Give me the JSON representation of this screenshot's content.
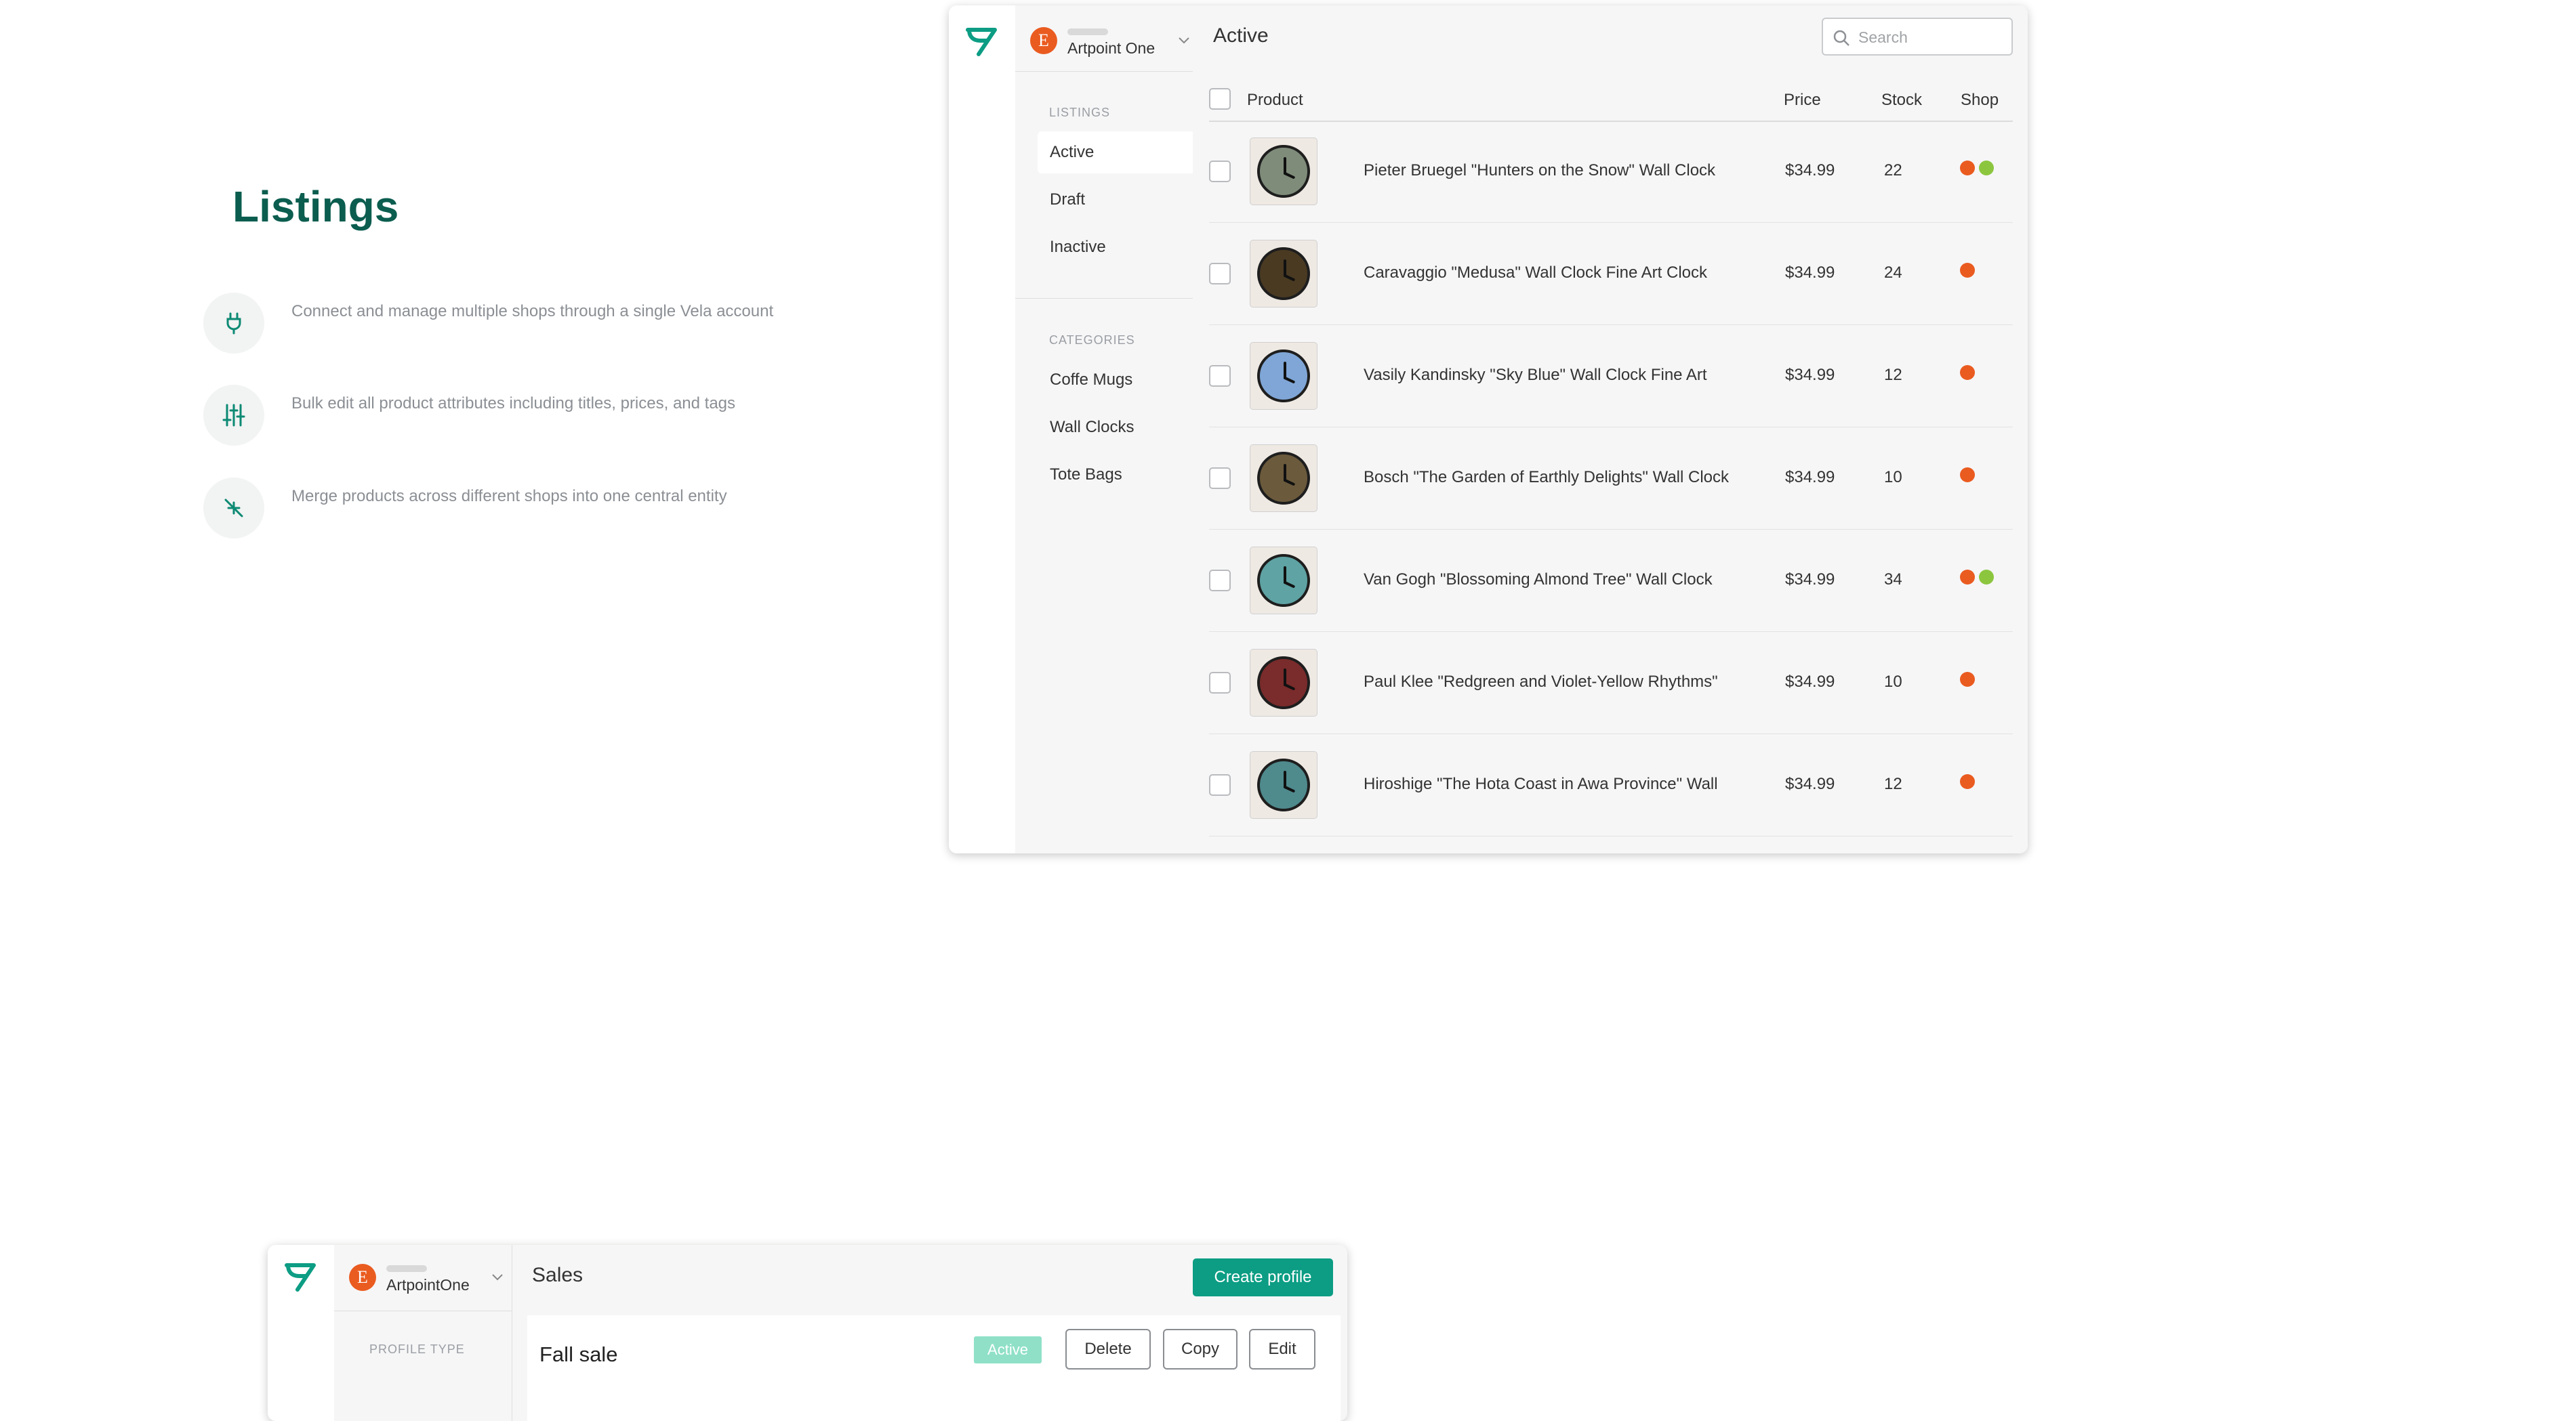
{
  "hero": {
    "title": "Listings",
    "features": [
      {
        "icon": "plug-icon",
        "text": "Connect and manage multiple shops through a single Vela account"
      },
      {
        "icon": "sliders-icon",
        "text": "Bulk edit all product attributes including titles, prices, and tags"
      },
      {
        "icon": "merge-arrows-icon",
        "text": "Merge products across different shops into one central entity"
      }
    ]
  },
  "listings_app": {
    "logo": "vela-logo-icon",
    "shop_selector": {
      "badge": "E",
      "name": "Artpoint One",
      "icon": "chevron-down-icon"
    },
    "sidebar": {
      "listings_heading": "LISTINGS",
      "listings": [
        {
          "label": "Active",
          "selected": true
        },
        {
          "label": "Draft",
          "selected": false
        },
        {
          "label": "Inactive",
          "selected": false
        }
      ],
      "categories_heading": "CATEGORIES",
      "categories": [
        {
          "label": "Coffe Mugs"
        },
        {
          "label": "Wall Clocks"
        },
        {
          "label": "Tote Bags"
        }
      ]
    },
    "page_title": "Active",
    "search": {
      "placeholder": "Search",
      "value": ""
    },
    "table": {
      "columns": {
        "product": "Product",
        "price": "Price",
        "stock": "Stock",
        "shop": "Shop"
      },
      "rows": [
        {
          "product": "Pieter Bruegel \"Hunters on the Snow\" Wall Clock",
          "price": "$34.99",
          "stock": "22",
          "shops": [
            "etsy",
            "shopify"
          ],
          "thumb_color": "#7f8c7a"
        },
        {
          "product": "Caravaggio \"Medusa\" Wall Clock Fine Art Clock",
          "price": "$34.99",
          "stock": "24",
          "shops": [
            "etsy"
          ],
          "thumb_color": "#4a3a22"
        },
        {
          "product": "Vasily Kandinsky \"Sky Blue\" Wall Clock Fine Art",
          "price": "$34.99",
          "stock": "12",
          "shops": [
            "etsy"
          ],
          "thumb_color": "#7fa6d6"
        },
        {
          "product": "Bosch \"The Garden of Earthly Delights\" Wall Clock",
          "price": "$34.99",
          "stock": "10",
          "shops": [
            "etsy"
          ],
          "thumb_color": "#6b5a3c"
        },
        {
          "product": "Van Gogh \"Blossoming Almond Tree\" Wall Clock",
          "price": "$34.99",
          "stock": "34",
          "shops": [
            "etsy",
            "shopify"
          ],
          "thumb_color": "#5fa3a4"
        },
        {
          "product": "Paul Klee \"Redgreen and Violet-Yellow Rhythms\"",
          "price": "$34.99",
          "stock": "10",
          "shops": [
            "etsy"
          ],
          "thumb_color": "#7a2b2b"
        },
        {
          "product": "Hiroshige \"The Hota Coast in Awa Province\" Wall",
          "price": "$34.99",
          "stock": "12",
          "shops": [
            "etsy"
          ],
          "thumb_color": "#4f8a8d"
        }
      ]
    },
    "shop_colors": {
      "etsy": "#ea5b20",
      "shopify": "#8cc63f"
    }
  },
  "sales_app": {
    "logo": "vela-logo-icon",
    "shop_selector": {
      "badge": "E",
      "name": "ArtpointOne",
      "icon": "chevron-down-icon"
    },
    "sidebar_heading": "PROFILE TYPE",
    "page_title": "Sales",
    "create_button": "Create profile",
    "profile": {
      "name": "Fall sale",
      "status": "Active"
    },
    "actions": {
      "delete": "Delete",
      "copy": "Copy",
      "edit": "Edit"
    }
  },
  "colors": {
    "brand_green": "#0b5d4f",
    "accent_teal": "#0c9d84"
  }
}
